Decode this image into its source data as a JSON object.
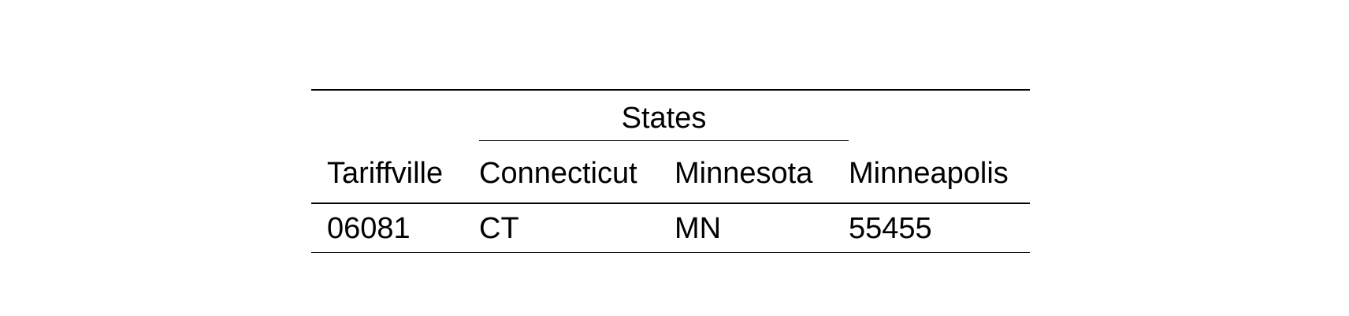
{
  "table": {
    "spanner_label": "States",
    "columns": [
      "Tariffville",
      "Connecticut",
      "Minnesota",
      "Minneapolis"
    ],
    "rows": [
      [
        "06081",
        "CT",
        "MN",
        "55455"
      ]
    ]
  }
}
